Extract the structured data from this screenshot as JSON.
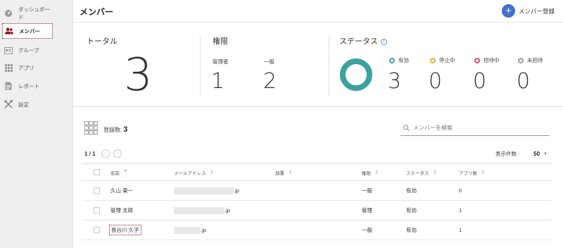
{
  "sidebar": {
    "items": [
      {
        "label": "ダッシュボード",
        "icon": "dashboard-icon"
      },
      {
        "label": "メンバー",
        "icon": "members-icon",
        "active": true
      },
      {
        "label": "グループ",
        "icon": "group-icon"
      },
      {
        "label": "アプリ",
        "icon": "apps-grid-icon"
      },
      {
        "label": "レポート",
        "icon": "report-icon"
      },
      {
        "label": "設定",
        "icon": "settings-tools-icon"
      }
    ]
  },
  "header": {
    "title": "メンバー",
    "add_button": "メンバー登録"
  },
  "stats": {
    "total": {
      "label": "トータル",
      "value": "3"
    },
    "roles": {
      "label": "権限",
      "admin": {
        "label": "管理者",
        "value": "1"
      },
      "general": {
        "label": "一般",
        "value": "2"
      }
    },
    "status": {
      "label": "ステータス",
      "items": [
        {
          "label": "有効",
          "value": "3",
          "color": "#3aa3a0"
        },
        {
          "label": "停止中",
          "value": "0",
          "color": "#e0b62a"
        },
        {
          "label": "招待中",
          "value": "0",
          "color": "#d94b6a"
        },
        {
          "label": "未招待",
          "value": "0",
          "color": "#9a9a9a"
        }
      ],
      "ring_color": "#3aa3a0"
    }
  },
  "list": {
    "registered_label": "登録数:",
    "registered_count": "3",
    "search_placeholder": "メンバーを検索",
    "page_indicator": "1 / 1",
    "per_page_label": "表示件数 :",
    "per_page_value": "50"
  },
  "table": {
    "columns": {
      "name": "名前",
      "email": "メールアドレス",
      "dept": "部署",
      "role": "権限",
      "status": "ステータス",
      "app_count": "アプリ数"
    },
    "rows": [
      {
        "name": "久山 東一",
        "email_domain": ".jp",
        "dept": "",
        "role": "一般",
        "status": "有効",
        "app_count": "0"
      },
      {
        "name": "管理 太郎",
        "email_domain": ".jp",
        "dept": "",
        "role": "管理",
        "status": "有効",
        "app_count": "1"
      },
      {
        "name": "長谷川 久子",
        "email_domain": ".jp",
        "dept": "",
        "role": "一般",
        "status": "有効",
        "app_count": "1"
      }
    ]
  }
}
